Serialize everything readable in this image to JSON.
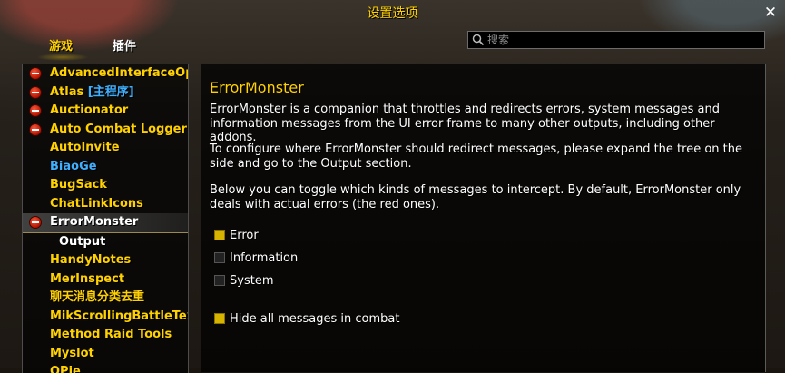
{
  "window": {
    "title": "设置选项"
  },
  "tabs": [
    {
      "label": "游戏",
      "active": true
    },
    {
      "label": "插件",
      "active": false
    }
  ],
  "search": {
    "placeholder": "搜索"
  },
  "addons": [
    {
      "label": "AdvancedInterfaceOp...",
      "icon": "minus-icon",
      "color": "gold"
    },
    {
      "label": "Atlas",
      "suffix": "[主程序]",
      "icon": "minus-icon",
      "color": "gold"
    },
    {
      "label": "Auctionator",
      "icon": "minus-icon",
      "color": "gold"
    },
    {
      "label": "Auto Combat Logger",
      "icon": "minus-icon",
      "color": "gold"
    },
    {
      "label": "AutoInvite",
      "color": "gold"
    },
    {
      "label": "BiaoGe",
      "color": "blue"
    },
    {
      "label": "BugSack",
      "color": "gold"
    },
    {
      "label": "ChatLinkIcons",
      "color": "gold"
    },
    {
      "label": "ErrorMonster",
      "icon": "minus-icon",
      "color": "white",
      "selected": true
    },
    {
      "label": "Output",
      "color": "white",
      "child": true
    },
    {
      "label": "HandyNotes",
      "color": "gold"
    },
    {
      "label": "MerInspect",
      "color": "gold"
    },
    {
      "label": "聊天消息分类去重",
      "color": "gold"
    },
    {
      "label": "MikScrollingBattleText",
      "color": "gold"
    },
    {
      "label": "Method Raid Tools",
      "color": "gold"
    },
    {
      "label": "Myslot",
      "color": "gold"
    },
    {
      "label": "OPie",
      "color": "gold"
    }
  ],
  "panel": {
    "title": "ErrorMonster",
    "paragraphs": [
      "ErrorMonster is a companion that throttles and redirects errors, system messages and information messages from the UI error frame to many other outputs, including other addons.",
      "To configure where ErrorMonster should redirect messages, please expand the tree on the side and go to the Output section.",
      "Below you can toggle which kinds of messages to intercept. By default, ErrorMonster only deals with actual errors (the red ones)."
    ],
    "options": [
      {
        "label": "Error",
        "checked": true
      },
      {
        "label": "Information",
        "checked": false
      },
      {
        "label": "System",
        "checked": false
      },
      {
        "label": "Hide all messages in combat",
        "checked": true
      }
    ]
  },
  "colors": {
    "gold": "#ffd100",
    "blue": "#3fb0ff",
    "white": "#ffffff",
    "check": "#d6b400"
  }
}
